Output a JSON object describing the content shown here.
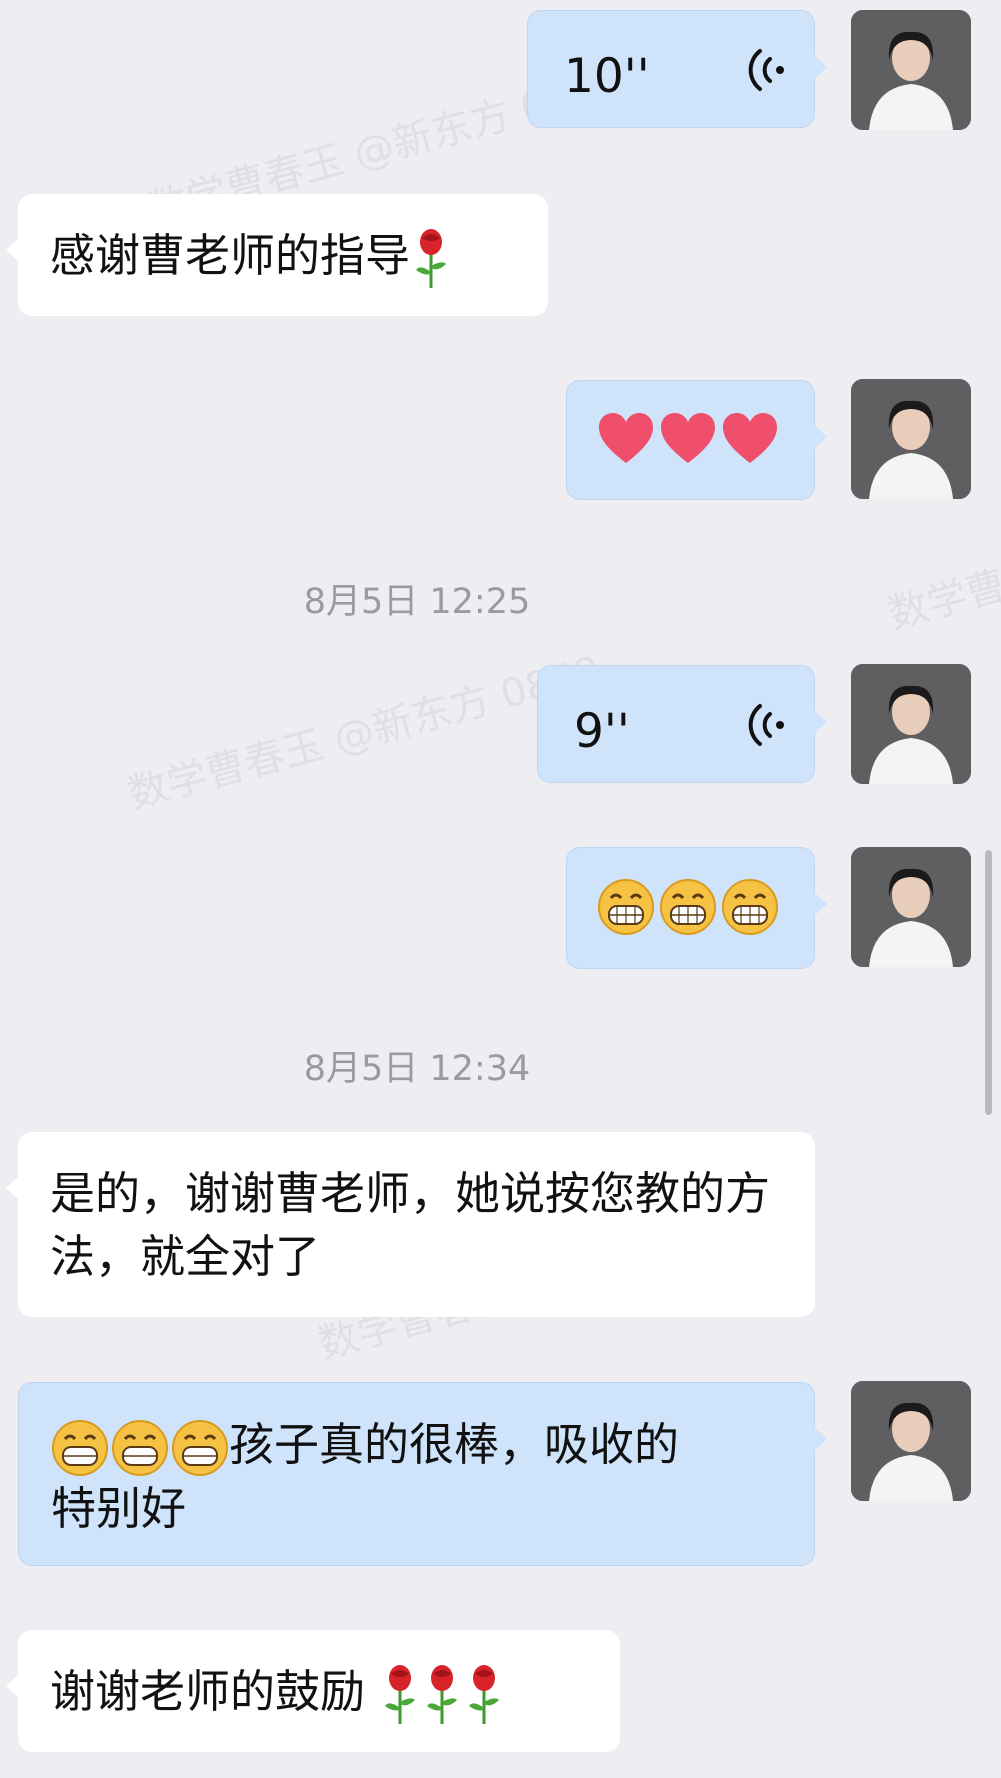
{
  "watermark": {
    "text": "数学曹春玉 @新东方 0849"
  },
  "timestamps": [
    "8月5日 12:25",
    "8月5日 12:34"
  ],
  "messages": {
    "m1_voice": {
      "duration": "10''"
    },
    "m2": {
      "text": "感谢曹老师的指导"
    },
    "m3": {
      "emojis": [
        "red-heart",
        "red-heart",
        "red-heart"
      ]
    },
    "m4_voice": {
      "duration": "9''"
    },
    "m5": {
      "emojis": [
        "grinning-face",
        "grinning-face",
        "grinning-face"
      ]
    },
    "m6": {
      "text": "是的，谢谢曹老师，她说按您教的方法，就全对了"
    },
    "m7": {
      "line1": "孩子真的很棒，吸收的",
      "line2": "特别好"
    },
    "m8": {
      "text": "谢谢老师的鼓励"
    }
  },
  "colors": {
    "background": "#ededf2",
    "incoming_bubble": "#ffffff",
    "outgoing_bubble": "#cfe4fb",
    "timestamp": "#9a9aa2"
  }
}
